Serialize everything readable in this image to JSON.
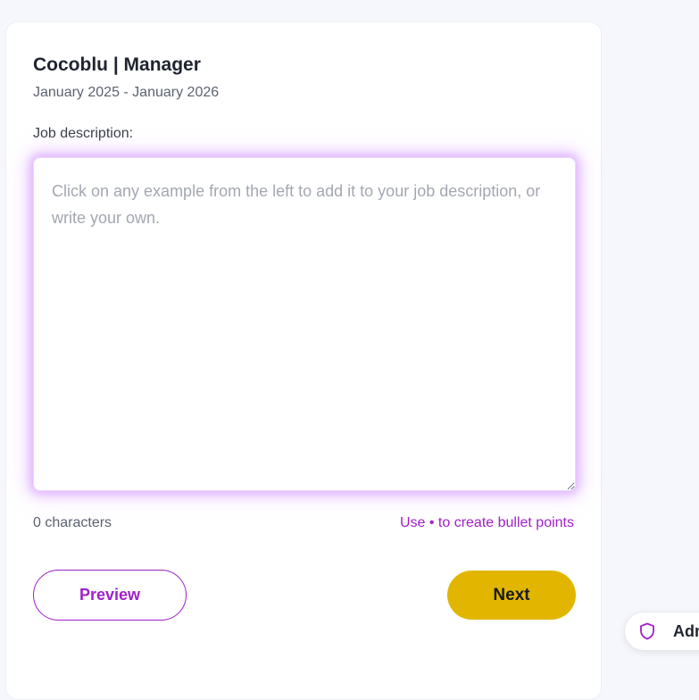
{
  "entry": {
    "title": "Cocoblu | Manager",
    "dates": "January 2025 - January 2026"
  },
  "description": {
    "label": "Job description:",
    "value": "",
    "placeholder": "Click on any example from the left to add it to your job description, or write your own.",
    "char_count": "0 characters",
    "bullet_hint": "Use • to create bullet points"
  },
  "actions": {
    "preview_label": "Preview",
    "next_label": "Next"
  },
  "admin_widget": {
    "label": "Admin",
    "icon": "shield-icon"
  },
  "colors": {
    "accent": "#a020c8",
    "primary_button": "#e2b600"
  }
}
